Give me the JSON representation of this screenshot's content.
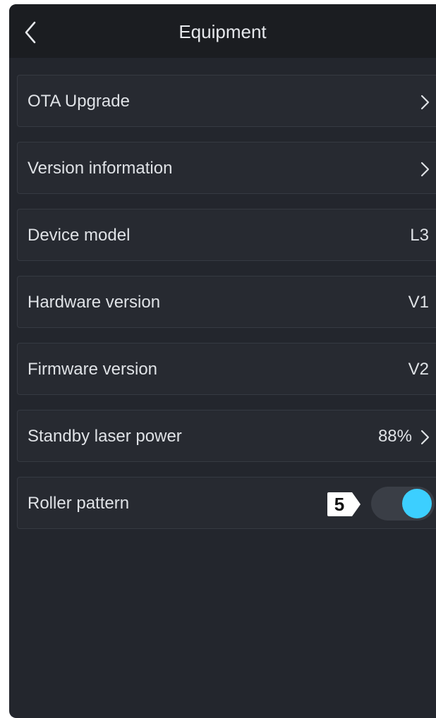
{
  "header": {
    "title": "Equipment",
    "back_icon": "chevron-left-icon"
  },
  "rows": [
    {
      "label": "OTA Upgrade",
      "value": "",
      "has_chevron": true
    },
    {
      "label": "Version information",
      "value": "",
      "has_chevron": true
    },
    {
      "label": "Device model",
      "value": "L3",
      "has_chevron": false
    },
    {
      "label": "Hardware version",
      "value": "V1",
      "has_chevron": false
    },
    {
      "label": "Firmware version",
      "value": "V2",
      "has_chevron": false
    },
    {
      "label": "Standby laser power",
      "value": "88%",
      "has_chevron": true
    },
    {
      "label": "Roller pattern",
      "value": "",
      "has_chevron": false,
      "toggle_on": true
    }
  ],
  "callout": {
    "number": "5"
  },
  "colors": {
    "background": "#23262d",
    "header": "#1b1d21",
    "toggle_knob": "#3ccfff",
    "text": "#dfe2e6"
  }
}
